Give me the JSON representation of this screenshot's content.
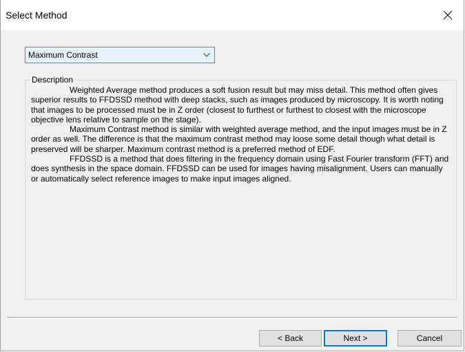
{
  "window": {
    "title": "Select Method"
  },
  "method_select": {
    "selected": "Maximum Contrast"
  },
  "description": {
    "legend": "Description",
    "paragraphs": [
      "Weighted Average method produces a soft fusion result but may miss detail. This method often gives superior results to FFDSSD method with deep stacks, such as images produced by microscopy. It is worth noting that images to be processed must be in Z order (closest to furthest or furthest to closest with the microscope objective lens relative to sample on the stage).",
      "Maximum Contrast method is similar with weighted average method, and the input images must be in Z order as well. The difference is that the maximum contrast method may loose some detail though what detail is preserved will be sharper. Maximum contrast method is a preferred method of EDF.",
      "FFDSSD is a method that does filtering in the frequency domain using Fast Fourier transform (FFT) and does synthesis in the space domain. FFDSSD can be used for images having misalignment. Users can manually or automatically select reference images to make input images aligned."
    ]
  },
  "buttons": {
    "back": "< Back",
    "next": "Next >",
    "cancel": "Cancel"
  },
  "icons": {
    "close": "close-icon",
    "dropdown": "chevron-down-icon"
  },
  "colors": {
    "accent": "#0078d7",
    "dropdown_bg": "#e5f1fb",
    "dialog_bg": "#f0f0f0"
  }
}
